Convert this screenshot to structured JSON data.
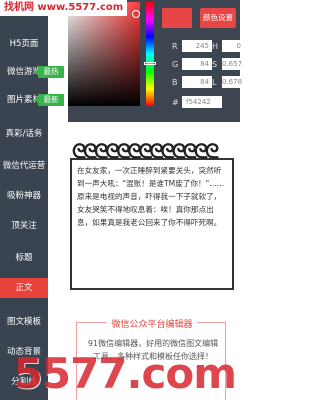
{
  "watermark": {
    "top": "找机网 www.5577.com",
    "bottom": "5577.com"
  },
  "sidebar": {
    "items": [
      {
        "label": "H5页面",
        "badge": ""
      },
      {
        "label": "微信游戏",
        "badge": "最热"
      },
      {
        "label": "图片素材",
        "badge": "最新"
      },
      {
        "label": "真彩/话务",
        "badge": ""
      },
      {
        "label": "微信代运营",
        "badge": ""
      },
      {
        "label": "吸粉神器",
        "badge": ""
      },
      {
        "label": "顶关注",
        "badge": ""
      },
      {
        "label": "标题",
        "badge": ""
      },
      {
        "label": "正文",
        "badge": ""
      },
      {
        "label": "图文模板",
        "badge": ""
      },
      {
        "label": "动态背景",
        "badge": ""
      },
      {
        "label": "分割线",
        "badge": ""
      }
    ],
    "active_index": 8
  },
  "color_picker": {
    "set_button": "颜色设置",
    "channels": [
      {
        "label": "R",
        "value": "245",
        "unit": ""
      },
      {
        "label": "H",
        "value": "0",
        "unit": ""
      },
      {
        "label": "G",
        "value": "84",
        "unit": ""
      },
      {
        "label": "S",
        "value": "0.657",
        "unit": ""
      },
      {
        "label": "B",
        "value": "84",
        "unit": ""
      },
      {
        "label": "L",
        "value": "0.678",
        "unit": ""
      }
    ],
    "hex_label": "#",
    "hex_value": "f54242",
    "accent_color": "#e84545"
  },
  "note": {
    "spiral": "ᘓᘓᘓᘓᘓᘓᘓᘓᘓᘓᘓᘓᘓ",
    "text": "在女友家，一次正睡醉到紧要关头，突然听到一声大吼：\"混账！是谁TM废了你！\"……原来是电视的声音，吓得我一下子就软了，女友哭笑不得地叹息着：唉！真你那点出息，如果真是我老公回来了你不得吓死啊。"
  },
  "card": {
    "title": "微信公众平台编辑器",
    "text": "91微信编辑器，好用的微信图文编辑工具，多种样式和模板任你选择！"
  }
}
